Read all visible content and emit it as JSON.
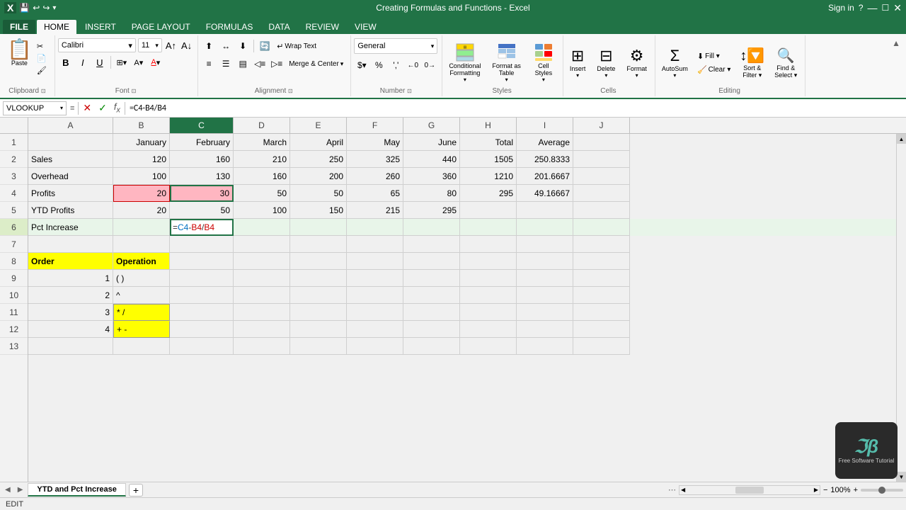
{
  "titleBar": {
    "title": "Creating Formulas and Functions - Excel",
    "appIcon": "X",
    "winControls": [
      "?",
      "—",
      "☐",
      "✕"
    ]
  },
  "quickAccess": {
    "buttons": [
      "💾",
      "↩",
      "↪",
      "▾"
    ]
  },
  "ribbon": {
    "tabs": [
      "FILE",
      "HOME",
      "INSERT",
      "PAGE LAYOUT",
      "FORMULAS",
      "DATA",
      "REVIEW",
      "VIEW"
    ],
    "activeTab": "HOME",
    "groups": {
      "clipboard": {
        "label": "Clipboard",
        "paste": "Paste"
      },
      "font": {
        "label": "Font",
        "fontName": "Calibri",
        "fontSize": "11",
        "bold": "B",
        "italic": "I",
        "underline": "U"
      },
      "alignment": {
        "label": "Alignment",
        "wrapText": "Wrap Text",
        "merge": "Merge & Center"
      },
      "number": {
        "label": "Number",
        "format": "General"
      },
      "styles": {
        "label": "Styles",
        "conditional": "Conditional Formatting",
        "formatAs": "Format as Table",
        "cellStyles": "Cell Styles"
      },
      "cells": {
        "label": "Cells",
        "insert": "Insert",
        "delete": "Delete",
        "format": "Format"
      },
      "editing": {
        "label": "Editing",
        "autosum": "AutoSum",
        "fill": "Fill",
        "clear": "Clear",
        "sort": "Sort & Filter",
        "find": "Find & Select"
      }
    }
  },
  "formulaBar": {
    "nameBox": "VLOOKUP",
    "formula": "=C4-B4/B4"
  },
  "columns": [
    "A",
    "B",
    "C",
    "D",
    "E",
    "F",
    "G",
    "H",
    "I",
    "J"
  ],
  "rows": [
    {
      "num": 1,
      "cells": {
        "A": "",
        "B": "January",
        "C": "February",
        "D": "March",
        "E": "April",
        "F": "May",
        "G": "June",
        "H": "Total",
        "I": "Average",
        "J": ""
      }
    },
    {
      "num": 2,
      "cells": {
        "A": "Sales",
        "B": "120",
        "C": "160",
        "D": "210",
        "E": "250",
        "F": "325",
        "G": "440",
        "H": "1505",
        "I": "250.8333",
        "J": ""
      }
    },
    {
      "num": 3,
      "cells": {
        "A": "Overhead",
        "B": "100",
        "C": "130",
        "D": "160",
        "E": "200",
        "F": "260",
        "G": "360",
        "H": "1210",
        "I": "201.6667",
        "J": ""
      }
    },
    {
      "num": 4,
      "cells": {
        "A": "Profits",
        "B": "20",
        "C": "30",
        "D": "50",
        "E": "50",
        "F": "65",
        "G": "80",
        "H": "295",
        "I": "49.16667",
        "J": ""
      }
    },
    {
      "num": 5,
      "cells": {
        "A": "YTD Profits",
        "B": "20",
        "C": "50",
        "D": "100",
        "E": "150",
        "F": "215",
        "G": "295",
        "H": "",
        "I": "",
        "J": ""
      }
    },
    {
      "num": 6,
      "cells": {
        "A": "Pct Increase",
        "B": "",
        "C": "=C4-B4/B4",
        "D": "",
        "E": "",
        "F": "",
        "G": "",
        "H": "",
        "I": "",
        "J": ""
      }
    },
    {
      "num": 7,
      "cells": {
        "A": "",
        "B": "",
        "C": "",
        "D": "",
        "E": "",
        "F": "",
        "G": "",
        "H": "",
        "I": "",
        "J": ""
      }
    },
    {
      "num": 8,
      "cells": {
        "A": "Order",
        "B": "Operation",
        "C": "",
        "D": "",
        "E": "",
        "F": "",
        "G": "",
        "H": "",
        "I": "",
        "J": ""
      }
    },
    {
      "num": 9,
      "cells": {
        "A": "1",
        "B": "( )",
        "C": "",
        "D": "",
        "E": "",
        "F": "",
        "G": "",
        "H": "",
        "I": "",
        "J": ""
      }
    },
    {
      "num": 10,
      "cells": {
        "A": "2",
        "B": "^",
        "C": "",
        "D": "",
        "E": "",
        "F": "",
        "G": "",
        "H": "",
        "I": "",
        "J": ""
      }
    },
    {
      "num": 11,
      "cells": {
        "A": "3",
        "B": "* /",
        "C": "",
        "D": "",
        "E": "",
        "F": "",
        "G": "",
        "H": "",
        "I": "",
        "J": ""
      }
    },
    {
      "num": 12,
      "cells": {
        "A": "4",
        "B": "+ -",
        "C": "",
        "D": "",
        "E": "",
        "F": "",
        "G": "",
        "H": "",
        "I": "",
        "J": ""
      }
    },
    {
      "num": 13,
      "cells": {
        "A": "",
        "B": "",
        "C": "",
        "D": "",
        "E": "",
        "F": "",
        "G": "",
        "H": "",
        "I": "",
        "J": ""
      }
    }
  ],
  "sheetTabs": {
    "active": "YTD and Pct Increase",
    "tabs": [
      "YTD and Pct Increase"
    ]
  },
  "statusBar": {
    "mode": "EDIT",
    "scrollButtons": [
      "◀",
      "▶"
    ]
  },
  "watermark": {
    "logo": "ℑβ",
    "text": "Free Software Tutorial"
  },
  "signIn": "Sign in"
}
